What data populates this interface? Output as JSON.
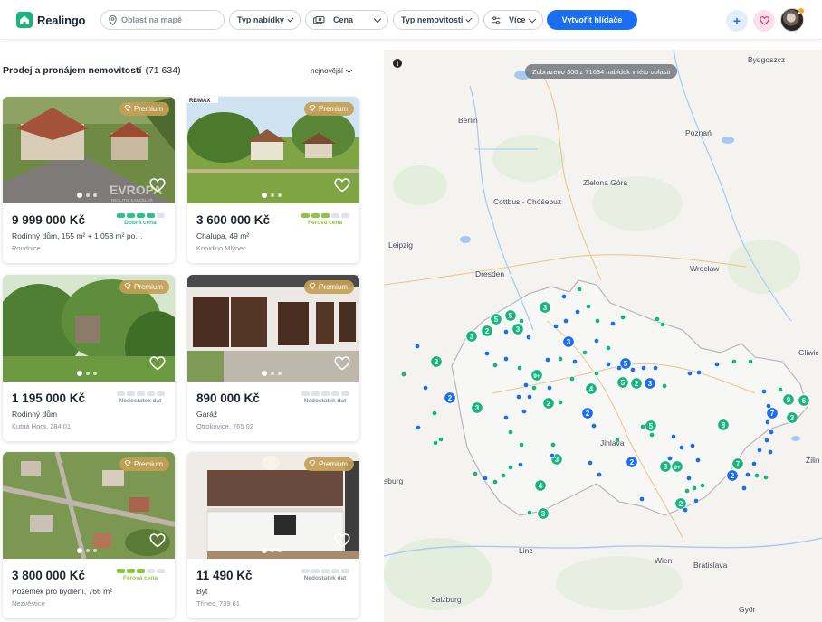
{
  "header": {
    "logo_text": "Realingo",
    "location_placeholder": "Oblast na mapě",
    "offer_type_label": "Typ nabídky",
    "price_label": "Cena",
    "property_type_label": "Typ nemovitosti",
    "more_label": "Více",
    "create_alert_label": "Vytvořit hlídače",
    "plus_label": "+"
  },
  "list": {
    "title": "Prodej a pronájem nemovitostí",
    "count": "(71 634)",
    "sort_label": "nejnovější"
  },
  "colors": {
    "brand": "#1ab57c",
    "accent": "#1a6ef3",
    "premium": "#c4a054",
    "rating_good": "#2cc38a",
    "rating_fair": "#8dc63f",
    "marker_blue": "#1a6ef3",
    "marker_green": "#16b67f"
  },
  "listings": [
    {
      "premium": "Premium",
      "price": "9 999 000 Kč",
      "desc": "Rodinný dům, 155 m² + 1 058 m² po…",
      "loc": "Roudnice",
      "rating_label": "Dobrá cena",
      "rating_level": 4,
      "rating_color": "#2cc38a",
      "watermark": "EVROPA",
      "watermark_sub": "REALITNÍ KANCELÁŘ"
    },
    {
      "premium": "Premium",
      "price": "3 600 000 Kč",
      "desc": "Chalupa, 49 m²",
      "loc": "Kopidlno Mlýnec",
      "rating_label": "Férová cena",
      "rating_level": 3,
      "rating_color": "#8dc63f",
      "brand_tag": "RE/MAX"
    },
    {
      "premium": "Premium",
      "price": "1 195 000 Kč",
      "desc": "Rodinný dům",
      "loc": "Kutná Hora, 284 01",
      "rating_label": "Nedostatek dat",
      "rating_level": 0,
      "rating_color": "#8a909c"
    },
    {
      "premium": "Premium",
      "price": "890 000 Kč",
      "desc": "Garáž",
      "loc": "Otrokovice, 765 02",
      "rating_label": "Nedostatek dat",
      "rating_level": 0,
      "rating_color": "#8a909c"
    },
    {
      "premium": "Premium",
      "price": "3 800 000 Kč",
      "desc": "Pozemek pro bydlení, 766 m²",
      "loc": "Nezvěstice",
      "rating_label": "Férová cena",
      "rating_level": 3,
      "rating_color": "#8dc63f"
    },
    {
      "premium": "Premium",
      "price": "11 490 Kč",
      "desc": "Byt",
      "loc": "Třinec, 739 61",
      "rating_label": "Nedostatek dat",
      "rating_level": 0,
      "rating_color": "#8a909c"
    }
  ],
  "map": {
    "info_label": "i",
    "banner": "Zobrazeno 300 z 71634 nabídek v této oblasti",
    "cities": [
      "Bydgoszcz",
      "Berlin",
      "Poznań",
      "Zielona Góra",
      "Cottbus - Chóśebuz",
      "Leipzig",
      "Wrocław",
      "Dresden",
      "Gliwic",
      "Jihlava",
      "Žilin",
      "sburg",
      "Linz",
      "Wien",
      "Bratislava",
      "Salzburg",
      "Győr"
    ],
    "clusters": [
      {
        "label": "3",
        "color": "#16b67f"
      },
      {
        "label": "5",
        "color": "#16b67f"
      },
      {
        "label": "5",
        "color": "#16b67f"
      },
      {
        "label": "2",
        "color": "#16b67f"
      },
      {
        "label": "3",
        "color": "#16b67f"
      },
      {
        "label": "3",
        "color": "#16b67f"
      },
      {
        "label": "2",
        "color": "#16b67f"
      },
      {
        "label": "3",
        "color": "#1a6ef3"
      },
      {
        "label": "3",
        "color": "#16b67f"
      },
      {
        "label": "9+",
        "color": "#16b67f"
      },
      {
        "label": "5",
        "color": "#1a6ef3"
      },
      {
        "label": "5",
        "color": "#16b67f"
      },
      {
        "label": "2",
        "color": "#16b67f"
      },
      {
        "label": "3",
        "color": "#1a6ef3"
      },
      {
        "label": "4",
        "color": "#16b67f"
      },
      {
        "label": "2",
        "color": "#1a6ef3"
      },
      {
        "label": "2",
        "color": "#16b67f"
      },
      {
        "label": "5",
        "color": "#16b67f"
      },
      {
        "label": "2",
        "color": "#1a6ef3"
      },
      {
        "label": "8",
        "color": "#16b67f"
      },
      {
        "label": "9",
        "color": "#16b67f"
      },
      {
        "label": "6",
        "color": "#16b67f"
      },
      {
        "label": "7",
        "color": "#1a6ef3"
      },
      {
        "label": "3",
        "color": "#16b67f"
      },
      {
        "label": "2",
        "color": "#1a6ef3"
      },
      {
        "label": "3",
        "color": "#16b67f"
      },
      {
        "label": "3",
        "color": "#16b67f"
      },
      {
        "label": "9+",
        "color": "#16b67f"
      },
      {
        "label": "7",
        "color": "#16b67f"
      },
      {
        "label": "2",
        "color": "#1a6ef3"
      },
      {
        "label": "4",
        "color": "#16b67f"
      },
      {
        "label": "3",
        "color": "#16b67f"
      },
      {
        "label": "2",
        "color": "#16b67f"
      }
    ]
  }
}
